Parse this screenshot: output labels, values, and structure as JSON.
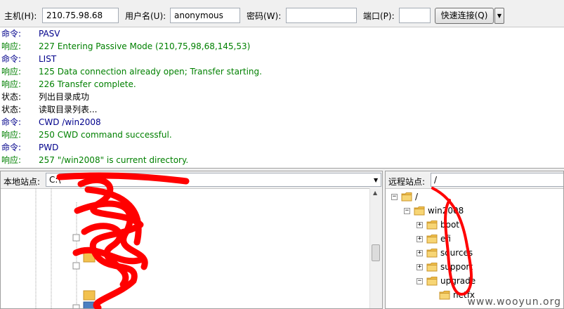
{
  "quickconnect": {
    "host_label": "主机(H):",
    "host_value": "210.75.98.68",
    "user_label": "用户名(U):",
    "user_value": "anonymous",
    "pass_label": "密码(W):",
    "pass_value": "",
    "port_label": "端口(P):",
    "port_value": "",
    "connect_button": "快速连接(Q)",
    "dropdown_arrow": "▼"
  },
  "log": [
    {
      "kind": "cmd",
      "key": "命令:",
      "msg": "PASV"
    },
    {
      "kind": "resp",
      "key": "响应:",
      "msg": "227 Entering Passive Mode (210,75,98,68,145,53)"
    },
    {
      "kind": "cmd",
      "key": "命令:",
      "msg": "LIST"
    },
    {
      "kind": "resp",
      "key": "响应:",
      "msg": "125 Data connection already open; Transfer starting."
    },
    {
      "kind": "resp",
      "key": "响应:",
      "msg": "226 Transfer complete."
    },
    {
      "kind": "stat",
      "key": "状态:",
      "msg": "列出目录成功"
    },
    {
      "kind": "stat",
      "key": "状态:",
      "msg": "读取目录列表..."
    },
    {
      "kind": "cmd",
      "key": "命令:",
      "msg": "CWD /win2008"
    },
    {
      "kind": "resp",
      "key": "响应:",
      "msg": "250 CWD command successful."
    },
    {
      "kind": "cmd",
      "key": "命令:",
      "msg": "PWD"
    },
    {
      "kind": "resp",
      "key": "响应:",
      "msg": "257 \"/win2008\" is current directory."
    }
  ],
  "local_site": {
    "label": "本地站点:",
    "path": "C:\\"
  },
  "remote_site": {
    "label": "远程站点:",
    "path": "/",
    "tree": [
      {
        "label": "/",
        "depth": 0,
        "expanded": true
      },
      {
        "label": "win2008",
        "depth": 1,
        "expanded": true
      },
      {
        "label": "boot",
        "depth": 2,
        "expanded": false
      },
      {
        "label": "efi",
        "depth": 2,
        "expanded": false
      },
      {
        "label": "sources",
        "depth": 2,
        "expanded": false
      },
      {
        "label": "support",
        "depth": 2,
        "expanded": false
      },
      {
        "label": "upgrade",
        "depth": 2,
        "expanded": true
      },
      {
        "label": "netfx",
        "depth": 3,
        "expanded": false
      }
    ]
  },
  "watermark": "www.wooyun.org",
  "colors": {
    "command": "#00008b",
    "response": "#008000",
    "annotation": "#ff0000",
    "folder": "#f2c14e"
  }
}
